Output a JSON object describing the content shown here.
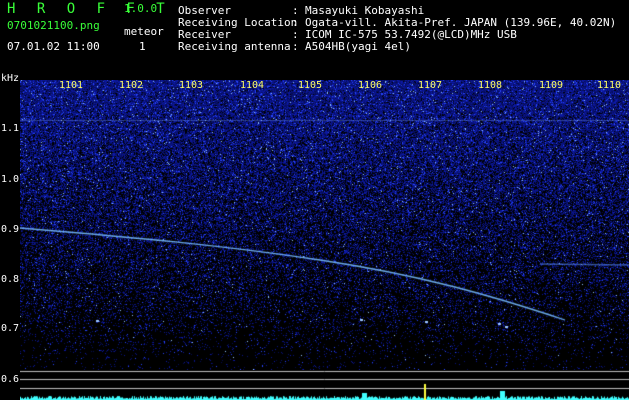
{
  "header": {
    "app_title": "H R O F F T",
    "app_version": "1.0.0",
    "filename": "0701021100.png",
    "datetime": "07.01.02 11:00",
    "meteor_label": "meteor",
    "meteor_count": "1"
  },
  "info": [
    {
      "label": "Observer",
      "sep": ":",
      "value": "Masayuki Kobayashi"
    },
    {
      "label": "Receiving Location",
      "sep": ":",
      "value": "Ogata-vill. Akita-Pref. JAPAN (139.96E, 40.02N)"
    },
    {
      "label": "Receiver",
      "sep": ":",
      "value": "ICOM IC-575 53.7492(@LCD)MHz USB"
    },
    {
      "label": "Receiving antenna",
      "sep": ":",
      "value": "A504HB(yagi 4el)"
    }
  ],
  "axis": {
    "y_unit": "kHz",
    "y_ticks": [
      "1.1",
      "1.0",
      "0.9",
      "0.8",
      "0.7",
      "0.6"
    ],
    "x_ticks": [
      "1101",
      "1102",
      "1103",
      "1104",
      "1105",
      "1106",
      "1107",
      "1108",
      "1109",
      "1110"
    ]
  },
  "colors": {
    "header_green": "#39ff39",
    "background": "#000000",
    "noise_blue": "#3a5cff",
    "trace_cyan": "#40ffff",
    "meteor_yellow": "#ffff40",
    "tick_yellow": "#ffff66"
  }
}
